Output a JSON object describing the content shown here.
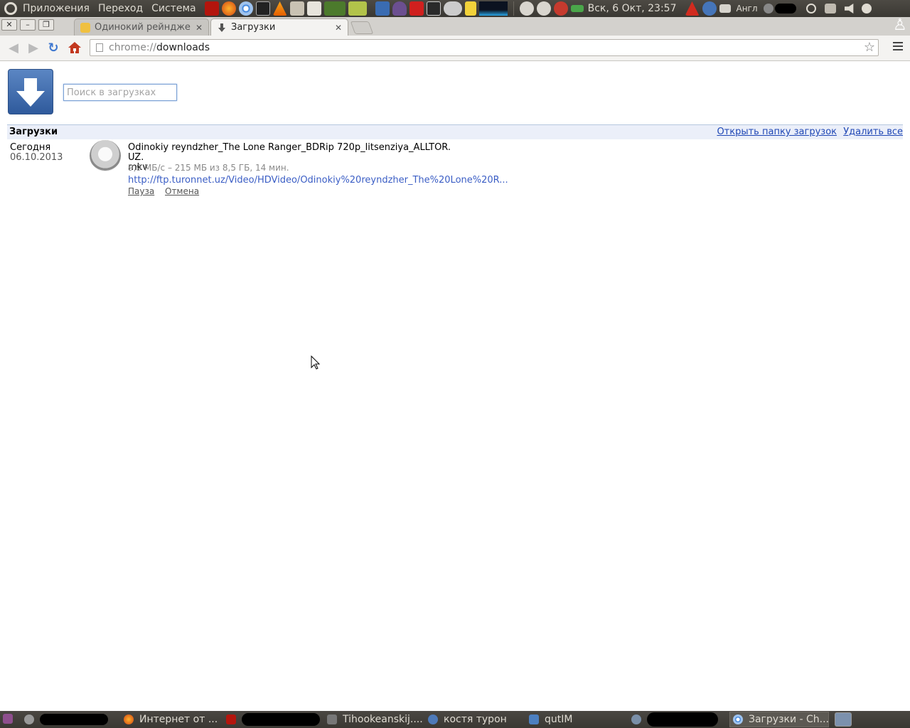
{
  "top_panel": {
    "menus": [
      "Приложения",
      "Переход",
      "Система"
    ],
    "clock": "Вск,  6 Окт, 23:57",
    "keyboard_layout": "Англ",
    "launcher_icons": [
      "filezilla-icon",
      "firefox-icon",
      "chromium-icon",
      "terminal-icon",
      "vlc-icon",
      "installer-icon",
      "screenshot-icon",
      "leaf-icon",
      "game-icon"
    ],
    "applet_icons": [
      "pidgin-icon",
      "ghost-icon",
      "power-red-icon",
      "lock-icon",
      "quote-icon",
      "note-icon",
      "network-graph-icon"
    ]
  },
  "browser": {
    "tabs": [
      {
        "title": "Одинокий рейнджер :",
        "favicon": "cr-icon",
        "active": false
      },
      {
        "title": "Загрузки",
        "favicon": "download-icon",
        "active": true
      }
    ],
    "address": {
      "scheme": "chrome://",
      "path": "downloads"
    }
  },
  "downloads_page": {
    "search_placeholder": "Поиск в загрузках",
    "header_title": "Загрузки",
    "open_folder_link": "Открыть папку загрузок",
    "clear_all_link": "Удалить все",
    "item": {
      "date_label": "Сегодня",
      "date": "06.10.2013",
      "file_name": "Odinokiy reyndzher_The Lone Ranger_BDRip 720p_litsenziya_ALLTOR.UZ.\nmkv",
      "status": "9,9 МБ/с – 215 МБ из 8,5 ГБ, 14 мин.",
      "url": "http://ftp.turonnet.uz/Video/HDVideo/Odinokiy%20reyndzher_The%20Lone%20R...",
      "pause_label": "Пауза",
      "cancel_label": "Отмена"
    }
  },
  "taskbar": [
    {
      "label": "",
      "icon": "email-icon"
    },
    {
      "label": "Интернет от ...",
      "icon": "firefox-icon"
    },
    {
      "label": "",
      "icon": "filezilla-icon"
    },
    {
      "label": "Tihookeanskij....",
      "icon": "clapper-icon"
    },
    {
      "label": "костя турон",
      "icon": "chat-icon"
    },
    {
      "label": "qutIM",
      "icon": "qutim-icon"
    },
    {
      "label": "",
      "icon": "chromium-icon"
    },
    {
      "label": "Загрузки - Ch...",
      "icon": "chromium-icon",
      "active": true
    }
  ],
  "colors": {
    "link": "#1f47b5",
    "url": "#3b5ec5",
    "header_bg": "#ebeff9",
    "panel": "#3c3b37"
  }
}
